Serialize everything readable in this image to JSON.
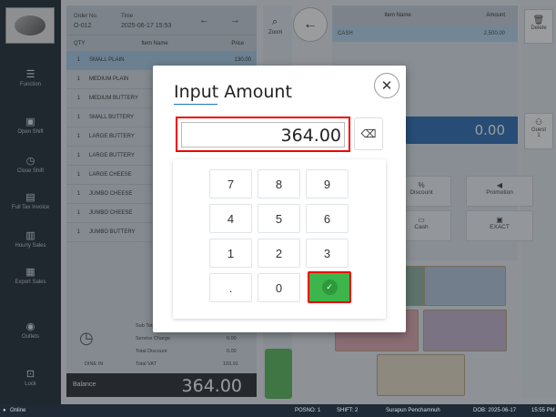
{
  "sidebar": {
    "items": [
      {
        "label": "Function",
        "icon": "menu-icon"
      },
      {
        "label": "Open Shift",
        "icon": "register-icon"
      },
      {
        "label": "Close Shift",
        "icon": "clock-icon"
      },
      {
        "label": "Full Tax Invoice",
        "icon": "invoice-icon"
      },
      {
        "label": "Hourly Sales",
        "icon": "chart-icon"
      },
      {
        "label": "Export Sales",
        "icon": "export-icon"
      },
      {
        "label": "Outlets",
        "icon": "location-icon"
      },
      {
        "label": "Lock",
        "icon": "lock-icon"
      }
    ]
  },
  "order": {
    "order_no_label": "Order No.",
    "order_no": "O-012",
    "time_label": "Time",
    "time": "2025-06-17 15:53",
    "col_qty": "QTY",
    "col_item": "Item Name",
    "col_price": "Price",
    "items": [
      {
        "qty": "1",
        "name": "SMALL PLAIN",
        "price": "130.00"
      },
      {
        "qty": "1",
        "name": "MEDIUM PLAIN",
        "price": ""
      },
      {
        "qty": "1",
        "name": "MEDIUM BUTTERY",
        "price": ""
      },
      {
        "qty": "1",
        "name": "SMALL BUTTERY",
        "price": ""
      },
      {
        "qty": "1",
        "name": "LARGE BUTTERY",
        "price": ""
      },
      {
        "qty": "1",
        "name": "LARGE BUTTERY",
        "price": ""
      },
      {
        "qty": "1",
        "name": "LARGE CHEESE",
        "price": ""
      },
      {
        "qty": "1",
        "name": "JUMBO CHEESE",
        "price": ""
      },
      {
        "qty": "1",
        "name": "JUMBO CHEESE",
        "price": ""
      },
      {
        "qty": "1",
        "name": "JUMBO BUTTERY",
        "price": ""
      }
    ],
    "sub_total_label": "Sub Total",
    "service_charge_label": "Service Charge",
    "service_charge": "0.00",
    "total_discount_label": "Total Discount",
    "total_discount": "0.00",
    "total_vat_label": "Total VAT",
    "total_vat": "193.91",
    "dine_in": "DINE IN",
    "balance_label": "Balance",
    "balance": "364.00"
  },
  "middle": {
    "zoom_label": "Zoom"
  },
  "payment": {
    "col_item": "Item Name",
    "col_amount": "Amount",
    "row_item": "CASH",
    "row_amount": "2,500.00",
    "remaining": "0.00",
    "delete_label": "Delete",
    "guest_label": "Guest",
    "guest_count": "1",
    "discount_label": "Discount",
    "promotion_label": "Promotion",
    "cash_label": "Cash",
    "exact_label": "EXACT"
  },
  "status": {
    "online": "Online",
    "pos_no": "POSNO: 1",
    "shift": "SHIFT: 2",
    "user": "Surapun Penchamnuh",
    "dob": "DOB: 2025-06-17",
    "time": "15:55 PM"
  },
  "modal": {
    "title": "Input Amount",
    "amount": "364.00",
    "keys": [
      "7",
      "8",
      "9",
      "4",
      "5",
      "6",
      "1",
      "2",
      "3",
      ".",
      "0"
    ]
  },
  "colors": {
    "accent": "#2f6db5",
    "confirm": "#3cb54a",
    "highlight": "#e00000",
    "sidebar": "#1f2a36"
  }
}
